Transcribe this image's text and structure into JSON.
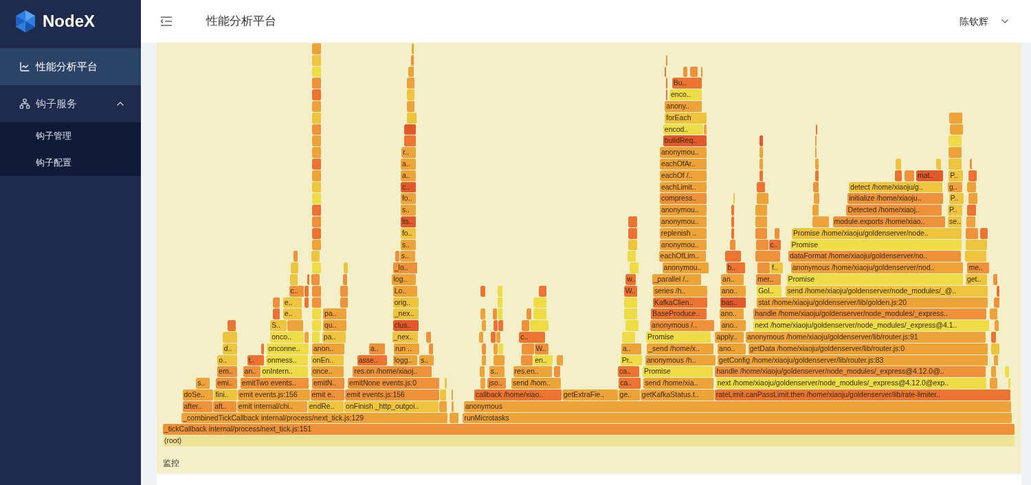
{
  "brand": {
    "name": "NodeX"
  },
  "sidebar": {
    "items": [
      {
        "label": "性能分析平台",
        "selected": true
      },
      {
        "label": "钩子服务",
        "selected": false,
        "expanded": true,
        "children": [
          {
            "label": "钩子管理",
            "selected": false
          },
          {
            "label": "钩子配置",
            "selected": false
          }
        ]
      }
    ]
  },
  "header": {
    "title": "性能分析平台",
    "user": "陈钦辉"
  },
  "flame_graph": {
    "rows": [
      {
        "frames": [
          {
            "color": "#eea33a"
          },
          {
            "color": "#eea33a"
          }
        ]
      },
      {
        "frames": [
          {
            "color": "#eec43e"
          },
          {
            "color": "#ed913a"
          },
          {
            "color": "#ed913a"
          }
        ]
      },
      {
        "frames": [
          {
            "color": "#eddc45"
          },
          {
            "color": "#eea33a"
          },
          {
            "color": "#ec7433"
          },
          {
            "color": "#ed913a"
          },
          {
            "color": "#ed913a"
          },
          {
            "color": "#ed913a"
          }
        ]
      },
      {
        "frames": [
          {
            "color": "#ed913a"
          },
          {
            "color": "#eea33a"
          },
          {
            "color": "#ec7433"
          },
          {
            "label": "Bu..",
            "color": "#ec7433"
          }
        ]
      },
      {
        "frames": [
          {
            "color": "#ec7433"
          },
          {
            "color": "#eec43e"
          },
          {
            "color": "#ec7433"
          },
          {
            "label": "enco..",
            "color": "#eddc45"
          }
        ]
      },
      {
        "frames": [
          {
            "color": "#eea33a"
          },
          {
            "color": "#eea33a"
          },
          {
            "label": "anony..",
            "color": "#eea33a"
          }
        ]
      },
      {
        "frames": [
          {
            "color": "#eec43e"
          },
          {
            "color": "#eec43e"
          },
          {
            "label": "forEach",
            "color": "#eec43e"
          },
          {
            "color": "#eea33a"
          }
        ]
      },
      {
        "frames": [
          {
            "color": "#ed913a"
          },
          {
            "color": "#e25a2c"
          },
          {
            "label": "encod..",
            "color": "#eddc45"
          },
          {
            "color": "#eea33a"
          },
          {
            "color": "#ec7433"
          },
          {
            "color": "#eea33a"
          }
        ]
      },
      {
        "frames": [
          {
            "color": "#eea33a"
          },
          {
            "color": "#ec7433"
          },
          {
            "label": "buildReq..",
            "color": "#e25a2c"
          },
          {
            "color": "#e25a2c"
          },
          {
            "color": "#eea33a"
          },
          {
            "color": "#eddc45"
          }
        ]
      },
      {
        "frames": [
          {
            "color": "#eea33a"
          },
          {
            "label": "r..",
            "color": "#eea33a"
          },
          {
            "label": "anonymou..",
            "color": "#eea33a"
          },
          {
            "color": "#eea33a"
          },
          {
            "color": "#eea33a"
          },
          {
            "color": "#eea33a"
          }
        ]
      },
      {
        "frames": [
          {
            "color": "#ec7433"
          },
          {
            "label": "a..",
            "color": "#eea33a"
          },
          {
            "label": "eachOfAr..",
            "color": "#eea33a"
          },
          {
            "color": "#eea33a"
          },
          {
            "color": "#eea33a"
          },
          {
            "color": "#eec43e"
          },
          {
            "color": "#eec43e"
          },
          {
            "color": "#eec43e"
          },
          {
            "color": "#ed913a"
          }
        ]
      },
      {
        "frames": [
          {
            "color": "#eea33a"
          },
          {
            "label": "a..",
            "color": "#eea33a"
          },
          {
            "label": "eachOf /..",
            "color": "#eea33a"
          },
          {
            "color": "#ec7433"
          },
          {
            "color": "#ec7433"
          },
          {
            "color": "#ec7433"
          },
          {
            "color": "#ed913a"
          },
          {
            "label": "mat..",
            "color": "#e25a2c"
          },
          {
            "label": "P..",
            "color": "#eec43e"
          },
          {
            "color": "#ec7433"
          }
        ]
      },
      {
        "frames": [
          {
            "color": "#eec43e"
          },
          {
            "label": "c..",
            "color": "#e25a2c"
          },
          {
            "label": "eachLimit..",
            "color": "#eea33a"
          },
          {
            "color": "#ec7433"
          },
          {
            "color": "#ed913a"
          },
          {
            "label": "detect /home/xiaoju/g..",
            "color": "#eec43e"
          },
          {
            "label": "g..",
            "color": "#eea33a"
          },
          {
            "color": "#eea33a"
          }
        ]
      },
      {
        "frames": [
          {
            "color": "#eddc45"
          },
          {
            "label": "fo..",
            "color": "#eea33a"
          },
          {
            "label": "compress..",
            "color": "#ed913a"
          },
          {
            "color": "#eec43e"
          },
          {
            "color": "#eea33a"
          },
          {
            "color": "#eea33a"
          },
          {
            "label": "initialize /home/xiaoju..",
            "color": "#ed913a"
          },
          {
            "label": "P..",
            "color": "#eec43e"
          },
          {
            "color": "#eea33a"
          }
        ]
      },
      {
        "frames": [
          {
            "color": "#ec7433"
          },
          {
            "label": "s..",
            "color": "#eea33a"
          },
          {
            "label": "anonymou..",
            "color": "#eea33a"
          },
          {
            "color": "#ec7433"
          },
          {
            "color": "#eea33a"
          },
          {
            "color": "#eea33a"
          },
          {
            "label": "Detected /home/xiaoj..",
            "color": "#ed913a"
          },
          {
            "label": "P..",
            "color": "#eec43e"
          },
          {
            "color": "#ec7433"
          }
        ]
      },
      {
        "frames": [
          {
            "color": "#ed913a"
          },
          {
            "label": "lis..",
            "color": "#e25a2c"
          },
          {
            "color": "#ec7433"
          },
          {
            "label": "anonymou..",
            "color": "#eea33a"
          },
          {
            "color": "#ec7433"
          },
          {
            "color": "#eea33a"
          },
          {
            "color": "#eea33a"
          },
          {
            "label": "module.exports /home/xiao..",
            "color": "#ed913a"
          },
          {
            "label": "se..",
            "color": "#eec43e"
          },
          {
            "color": "#eea33a"
          }
        ]
      },
      {
        "frames": [
          {
            "color": "#ec7433"
          },
          {
            "label": "fo..",
            "color": "#eec43e"
          },
          {
            "color": "#ec7433"
          },
          {
            "label": "replenish ..",
            "color": "#eea33a"
          },
          {
            "color": "#ec7433"
          },
          {
            "color": "#ed913a"
          },
          {
            "color": "#ed913a"
          },
          {
            "label": "Promise /home/xiaoju/goldenserver/node..",
            "color": "#eec43e"
          },
          {
            "color": "#ed913a"
          },
          {
            "color": "#ec7433"
          }
        ]
      },
      {
        "frames": [
          {
            "color": "#eea33a"
          },
          {
            "label": "s..",
            "color": "#eea33a"
          },
          {
            "color": "#eec43e"
          },
          {
            "label": "anonymou..",
            "color": "#eea33a"
          },
          {
            "color": "#ed913a"
          },
          {
            "color": "#ed913a"
          },
          {
            "label": "c..",
            "color": "#ec7433"
          },
          {
            "label": "Promise",
            "color": "#eddc45"
          },
          {
            "color": "#eec43e"
          }
        ]
      },
      {
        "frames": [
          {
            "color": "#ed913a"
          },
          {
            "color": "#eec43e"
          },
          {
            "color": "#ed913a"
          },
          {
            "label": "s..",
            "color": "#eea33a"
          },
          {
            "color": "#eddc45"
          },
          {
            "label": "eachOfLim..",
            "color": "#eea33a"
          },
          {
            "color": "#ec7433"
          },
          {
            "color": "#ed913a"
          },
          {
            "label": "dataFormat /home/xiaoju/goldenserver/no..",
            "color": "#ed913a"
          },
          {
            "color": "#eec43e"
          }
        ]
      },
      {
        "frames": [
          {
            "color": "#eec43e"
          },
          {
            "color": "#eddc45"
          },
          {
            "color": "#eec43e"
          },
          {
            "label": "_lo..",
            "color": "#ed913a"
          },
          {
            "color": "#eddc45"
          },
          {
            "label": "anonymou..",
            "color": "#eea33a"
          },
          {
            "label": "b..",
            "color": "#ec7433"
          },
          {
            "color": "#ed913a"
          },
          {
            "label": "f..",
            "color": "#eec43e"
          },
          {
            "label": "anonymous /home/xiaoju/goldenserver/nod..",
            "color": "#eea33a"
          },
          {
            "label": "me..",
            "color": "#ed913a"
          }
        ]
      },
      {
        "frames": [
          {
            "color": "#eec43e"
          },
          {
            "color": "#ec7433"
          },
          {
            "color": "#ed913a"
          },
          {
            "color": "#ed913a"
          },
          {
            "label": "log..",
            "color": "#eea33a"
          },
          {
            "label": "w..",
            "color": "#ec7433"
          },
          {
            "label": "_parallel /..",
            "color": "#eea33a"
          },
          {
            "label": "an..",
            "color": "#eea33a"
          },
          {
            "label": "mer..",
            "color": "#ed913a"
          },
          {
            "label": "Promise",
            "color": "#eddc45"
          },
          {
            "label": "get..",
            "color": "#eec43e"
          },
          {
            "color": "#ed913a"
          }
        ]
      },
      {
        "frames": [
          {
            "label": "c..",
            "color": "#ed913a"
          },
          {
            "color": "#ec7433"
          },
          {
            "color": "#ed913a"
          },
          {
            "color": "#ed913a"
          },
          {
            "label": "Lo..",
            "color": "#eea33a"
          },
          {
            "color": "#ec7433"
          },
          {
            "color": "#eddc45"
          },
          {
            "color": "#ec7433"
          },
          {
            "label": "W..",
            "color": "#ec7433"
          },
          {
            "label": "series /h..",
            "color": "#eea33a"
          },
          {
            "label": "ano..",
            "color": "#eea33a"
          },
          {
            "label": "Gol..",
            "color": "#eddc45"
          },
          {
            "label": "send /home/xiaoju/goldenserver/node_modules/_@..",
            "color": "#eec43e"
          },
          {
            "color": "#ec7433"
          }
        ]
      },
      {
        "frames": [
          {
            "color": "#ed913a"
          },
          {
            "label": "e..",
            "color": "#eec43e"
          },
          {
            "color": "#ec7433"
          },
          {
            "color": "#ed913a"
          },
          {
            "color": "#ed913a"
          },
          {
            "label": "orig..",
            "color": "#eec43e"
          },
          {
            "color": "#eddc45"
          },
          {
            "color": "#eddc45"
          },
          {
            "color": "#eddc45"
          },
          {
            "label": "KafkaClien..",
            "color": "#ec7433"
          },
          {
            "label": "bas..",
            "color": "#e25a2c"
          },
          {
            "label": "stat /home/xiaoju/goldenserver/lib/golden.js:20",
            "color": "#eea33a"
          },
          {
            "color": "#ed913a"
          }
        ]
      },
      {
        "frames": [
          {
            "color": "#ec7433"
          },
          {
            "label": "e..",
            "color": "#eec43e"
          },
          {
            "color": "#eddc45"
          },
          {
            "label": "pa..",
            "color": "#eea33a"
          },
          {
            "label": "_nex..",
            "color": "#eec43e"
          },
          {
            "color": "#eea33a"
          },
          {
            "color": "#ed913a"
          },
          {
            "color": "#eddc45"
          },
          {
            "color": "#ed913a"
          },
          {
            "color": "#eddc45"
          },
          {
            "color": "#eddc45"
          },
          {
            "label": "BaseProduce..",
            "color": "#ec7433"
          },
          {
            "label": "ano..",
            "color": "#eea33a"
          },
          {
            "label": "handle /home/xiaoju/goldenserver/node_modules/_express..",
            "color": "#ed913a"
          },
          {
            "color": "#eea33a"
          }
        ]
      },
      {
        "frames": [
          {
            "color": "#ec7433"
          },
          {
            "label": "S..",
            "color": "#eec43e"
          },
          {
            "color": "#eea33a"
          },
          {
            "color": "#eddc45"
          },
          {
            "label": "qu..",
            "color": "#eea33a"
          },
          {
            "label": "clus..",
            "color": "#e25a2c"
          },
          {
            "color": "#eea33a"
          },
          {
            "color": "#ec7433"
          },
          {
            "color": "#ec7433"
          },
          {
            "color": "#ed913a"
          },
          {
            "color": "#eddc45"
          },
          {
            "color": "#eddc45"
          },
          {
            "label": "anonymous /..",
            "color": "#ed913a"
          },
          {
            "label": "ano..",
            "color": "#eea33a"
          },
          {
            "label": "next /home/xiaoju/goldenserver/node_modules/_express@4.1..",
            "color": "#eddc45"
          },
          {
            "color": "#eea33a"
          }
        ]
      },
      {
        "frames": [
          {
            "color": "#eec43e"
          },
          {
            "label": "onco..",
            "color": "#eddc45"
          },
          {
            "color": "#eea33a"
          },
          {
            "color": "#eddc45"
          },
          {
            "label": "pa..",
            "color": "#eec43e"
          },
          {
            "label": "_nex..",
            "color": "#eec43e"
          },
          {
            "color": "#ed913a"
          },
          {
            "color": "#eea33a"
          },
          {
            "color": "#ec7433"
          },
          {
            "color": "#eea33a"
          },
          {
            "label": "c..",
            "color": "#ec7433"
          },
          {
            "color": "#eddc45"
          },
          {
            "label": "Promise",
            "color": "#eddc45"
          },
          {
            "label": "apply..",
            "color": "#eea33a"
          },
          {
            "label": "anonymous /home/xiaoju/goldenserver/lib/router.js:91",
            "color": "#eea33a"
          },
          {
            "color": "#ec7433"
          }
        ]
      },
      {
        "frames": [
          {
            "label": "d..",
            "color": "#eec43e"
          },
          {
            "color": "#ec7433"
          },
          {
            "label": "onconne..",
            "color": "#eddc45"
          },
          {
            "label": "anon..",
            "color": "#eea33a"
          },
          {
            "label": "a..",
            "color": "#ed913a"
          },
          {
            "label": "run ..",
            "color": "#eea33a"
          },
          {
            "color": "#ed913a"
          },
          {
            "color": "#ed913a"
          },
          {
            "color": "#eea33a"
          },
          {
            "color": "#eddc45"
          },
          {
            "color": "#ed913a"
          },
          {
            "label": "W..",
            "color": "#ed913a"
          },
          {
            "label": "a..",
            "color": "#eea33a"
          },
          {
            "label": "_send /home/x..",
            "color": "#eea33a"
          },
          {
            "label": "ano..",
            "color": "#eea33a"
          },
          {
            "label": "getData /home/xiaoju/goldenserver/lib/router.js:0",
            "color": "#eea33a"
          },
          {
            "color": "#eec43e"
          }
        ]
      },
      {
        "frames": [
          {
            "label": "o..",
            "color": "#eec43e"
          },
          {
            "label": "t..",
            "color": "#ec7433"
          },
          {
            "label": "onmess..",
            "color": "#eddc45"
          },
          {
            "label": "onEn..",
            "color": "#eec43e"
          },
          {
            "label": "asse..",
            "color": "#ec7433"
          },
          {
            "label": "logg..",
            "color": "#eea33a"
          },
          {
            "label": "s..",
            "color": "#eea33a"
          },
          {
            "color": "#eea33a"
          },
          {
            "color": "#eea33a"
          },
          {
            "color": "#ed913a"
          },
          {
            "label": "en..",
            "color": "#eddc45"
          },
          {
            "color": "#eea33a"
          },
          {
            "label": "Pr..",
            "color": "#eddc45"
          },
          {
            "label": "anonymous /h..",
            "color": "#eea33a"
          },
          {
            "label": "getConfig /home/xiaoju/goldenserver/lib/router.js:83",
            "color": "#eea33a"
          },
          {
            "color": "#eea33a"
          }
        ]
      },
      {
        "frames": [
          {
            "label": "em..",
            "color": "#ed913a"
          },
          {
            "label": "an..",
            "color": "#ed913a"
          },
          {
            "label": "onIntern..",
            "color": "#eddc45"
          },
          {
            "label": "once..",
            "color": "#eea33a"
          },
          {
            "label": "res.on /home/xiaoj..",
            "color": "#ed913a"
          },
          {
            "color": "#eea33a"
          },
          {
            "label": "s..",
            "color": "#eea33a"
          },
          {
            "label": "res.en..",
            "color": "#eea33a"
          },
          {
            "color": "#ed913a"
          },
          {
            "label": "ca..",
            "color": "#ec7433"
          },
          {
            "label": "Promise",
            "color": "#eddc45"
          },
          {
            "label": "handle /home/xiaoju/goldenserver/node_modules/_express@4.12.0@..",
            "color": "#ed913a"
          },
          {
            "color": "#eea33a"
          },
          {
            "color": "#eddc45"
          }
        ]
      },
      {
        "frames": [
          {
            "label": "s..",
            "color": "#eea33a"
          },
          {
            "label": "emi..",
            "color": "#ed913a"
          },
          {
            "label": "emitTwo events..",
            "color": "#ed913a"
          },
          {
            "label": "emitN..",
            "color": "#ed913a"
          },
          {
            "label": "emitNone events.js:0",
            "color": "#ed913a"
          },
          {
            "color": "#eec43e"
          },
          {
            "color": "#eea33a"
          },
          {
            "label": "jso..",
            "color": "#ed913a"
          },
          {
            "label": "send /hom..",
            "color": "#eea33a"
          },
          {
            "label": "ca..",
            "color": "#ec7433"
          },
          {
            "label": "send /home/xia..",
            "color": "#eea33a"
          },
          {
            "label": "next /home/xiaoju/goldenserver/node_modules/_express@4.12.0@exp..",
            "color": "#eddc45"
          },
          {
            "color": "#eea33a"
          },
          {
            "color": "#eddc45"
          }
        ]
      },
      {
        "frames": [
          {
            "label": "doSe..",
            "color": "#eea33a"
          },
          {
            "label": "fini..",
            "color": "#eec43e"
          },
          {
            "label": "emit events.js:156",
            "color": "#eea33a"
          },
          {
            "label": "emit e..",
            "color": "#ed913a"
          },
          {
            "label": "emit events.js:156",
            "color": "#ed913a"
          },
          {
            "color": "#eec43e"
          },
          {
            "color": "#eea33a"
          },
          {
            "label": "callback /home/xiao..",
            "color": "#ec7433"
          },
          {
            "label": "getExtraFie..",
            "color": "#eea33a"
          },
          {
            "label": "ge..",
            "color": "#eea33a"
          },
          {
            "label": "getKafkaStatus.t..",
            "color": "#eea33a"
          },
          {
            "label": "rateLimit.canPassLimit.then /home/xiaoju/goldenserver/lib/rate-limiter..",
            "color": "#ec7433"
          }
        ]
      },
      {
        "frames": [
          {
            "label": "after..",
            "color": "#ed913a"
          },
          {
            "label": "aft..",
            "color": "#ed913a"
          },
          {
            "label": "emit internal/chi..",
            "color": "#eea33a"
          },
          {
            "label": "endRe..",
            "color": "#eec43e"
          },
          {
            "label": "onFinish _http_outgoi..",
            "color": "#eec43e"
          },
          {
            "color": "#eea33a"
          },
          {
            "color": "#eea33a"
          },
          {
            "label": "anonymous",
            "color": "#eea33a"
          }
        ]
      },
      {
        "frames": [
          {
            "label": "_combinedTickCallback internal/process/next_tick.js:129",
            "color": "#eea33a"
          },
          {
            "color": "#eea33a"
          },
          {
            "label": "runMicrotasks",
            "color": "#eea33a"
          }
        ]
      },
      {
        "frames": [
          {
            "label": "_tickCallback internal/process/next_tick.js:151",
            "color": "#ed913a"
          }
        ]
      },
      {
        "frames": [
          {
            "label": "(root)",
            "color": "#efe39a"
          }
        ]
      }
    ],
    "footer_label": "监控"
  }
}
